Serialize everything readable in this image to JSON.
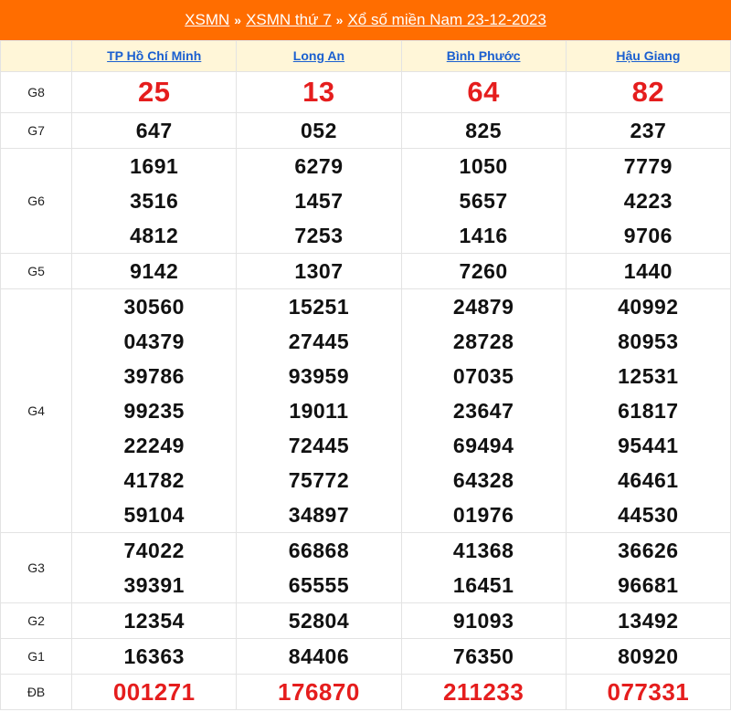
{
  "breadcrumb": {
    "items": [
      "XSMN",
      "XSMN thứ 7",
      "Xổ số miền Nam 23-12-2023"
    ],
    "separator": "»"
  },
  "colors": {
    "header_bg": "#ff6d00",
    "province_row_bg": "#fff6d8",
    "province_link": "#1a5fd0",
    "highlight_red": "#e51d1d"
  },
  "provinces": [
    "TP Hồ Chí Minh",
    "Long An",
    "Bình Phước",
    "Hậu Giang"
  ],
  "prizes": [
    {
      "label": "G8",
      "values": [
        [
          "25"
        ],
        [
          "13"
        ],
        [
          "64"
        ],
        [
          "82"
        ]
      ]
    },
    {
      "label": "G7",
      "values": [
        [
          "647"
        ],
        [
          "052"
        ],
        [
          "825"
        ],
        [
          "237"
        ]
      ]
    },
    {
      "label": "G6",
      "values": [
        [
          "1691",
          "3516",
          "4812"
        ],
        [
          "6279",
          "1457",
          "7253"
        ],
        [
          "1050",
          "5657",
          "1416"
        ],
        [
          "7779",
          "4223",
          "9706"
        ]
      ]
    },
    {
      "label": "G5",
      "values": [
        [
          "9142"
        ],
        [
          "1307"
        ],
        [
          "7260"
        ],
        [
          "1440"
        ]
      ]
    },
    {
      "label": "G4",
      "values": [
        [
          "30560",
          "04379",
          "39786",
          "99235",
          "22249",
          "41782",
          "59104"
        ],
        [
          "15251",
          "27445",
          "93959",
          "19011",
          "72445",
          "75772",
          "34897"
        ],
        [
          "24879",
          "28728",
          "07035",
          "23647",
          "69494",
          "64328",
          "01976"
        ],
        [
          "40992",
          "80953",
          "12531",
          "61817",
          "95441",
          "46461",
          "44530"
        ]
      ]
    },
    {
      "label": "G3",
      "values": [
        [
          "74022",
          "39391"
        ],
        [
          "66868",
          "65555"
        ],
        [
          "41368",
          "16451"
        ],
        [
          "36626",
          "96681"
        ]
      ]
    },
    {
      "label": "G2",
      "values": [
        [
          "12354"
        ],
        [
          "52804"
        ],
        [
          "91093"
        ],
        [
          "13492"
        ]
      ]
    },
    {
      "label": "G1",
      "values": [
        [
          "16363"
        ],
        [
          "84406"
        ],
        [
          "76350"
        ],
        [
          "80920"
        ]
      ]
    },
    {
      "label": "ĐB",
      "values": [
        [
          "001271"
        ],
        [
          "176870"
        ],
        [
          "211233"
        ],
        [
          "077331"
        ]
      ]
    }
  ]
}
